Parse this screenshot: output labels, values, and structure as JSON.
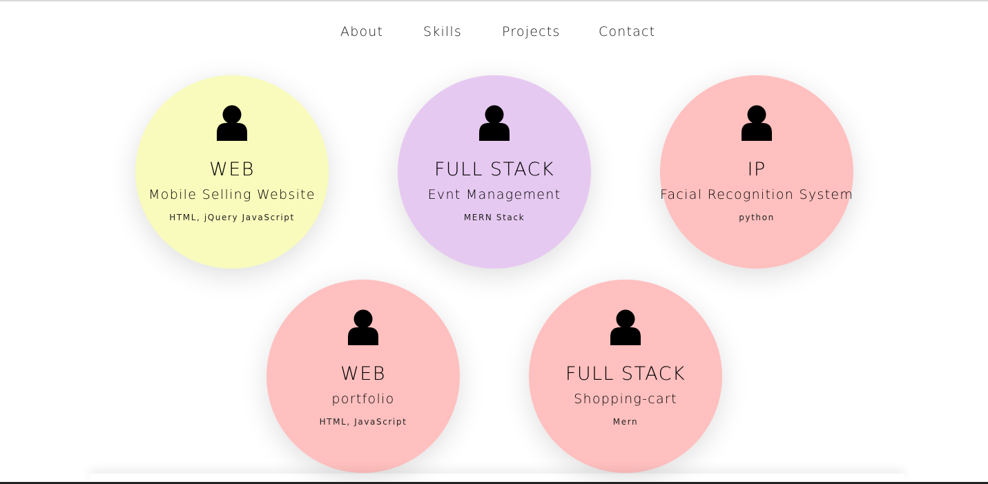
{
  "nav": {
    "items": [
      {
        "label": "About"
      },
      {
        "label": "Skills"
      },
      {
        "label": "Projects"
      },
      {
        "label": "Contact"
      }
    ]
  },
  "projects": [
    {
      "category": "WEB",
      "title": "Mobile Selling Website",
      "tech": "HTML, jQuery JavaScript",
      "color": "#f8fbbc",
      "icon": "user-icon"
    },
    {
      "category": "FULL STACK",
      "title": "Evnt Management",
      "tech": "MERN Stack",
      "color": "#e6c9f1",
      "icon": "user-icon"
    },
    {
      "category": "IP",
      "title": "Facial Recognition System",
      "tech": "python",
      "color": "#ffc0bf",
      "icon": "user-icon"
    },
    {
      "category": "WEB",
      "title": "portfolio",
      "tech": "HTML, JavaScript",
      "color": "#ffc0bf",
      "icon": "user-icon"
    },
    {
      "category": "FULL STACK",
      "title": "Shopping-cart",
      "tech": "Mern",
      "color": "#ffc0bf",
      "icon": "user-icon"
    }
  ]
}
